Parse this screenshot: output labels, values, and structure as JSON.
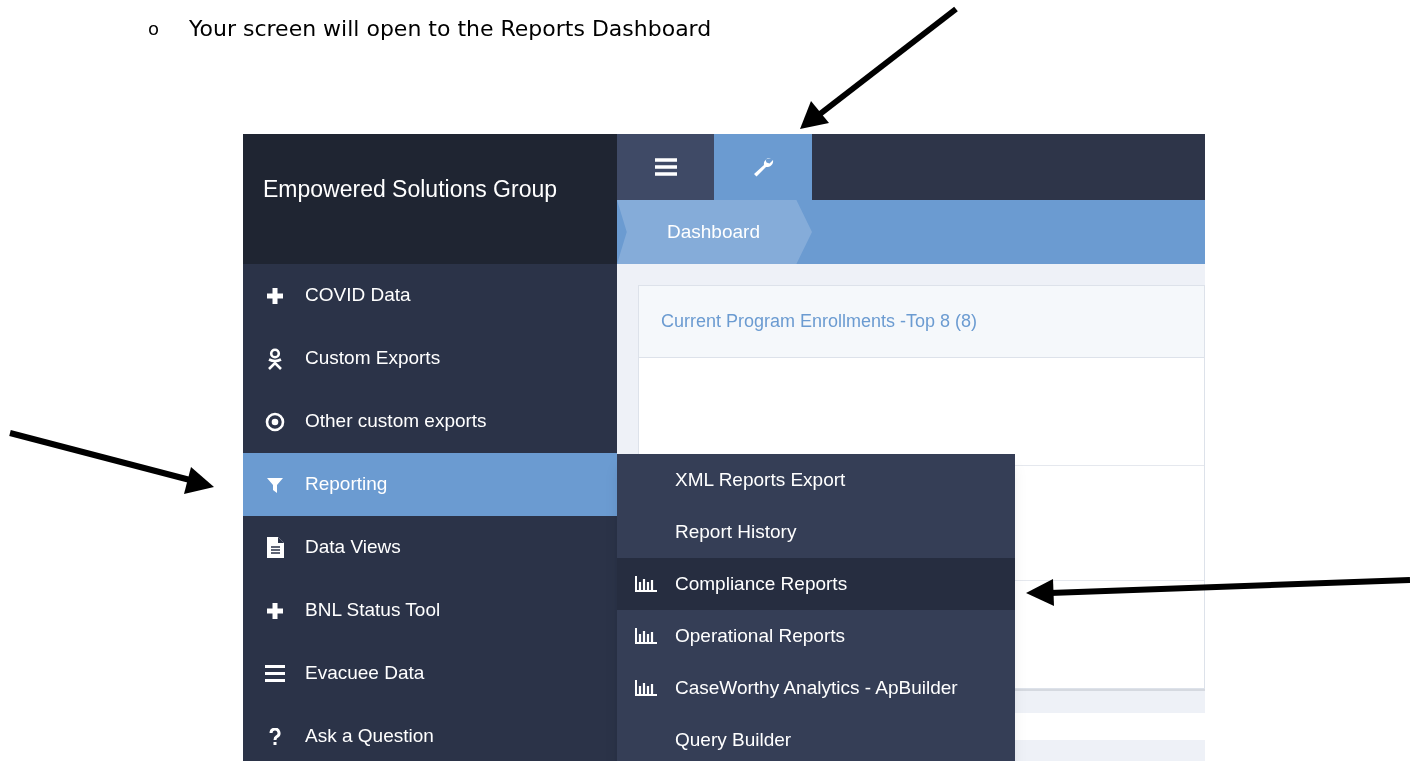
{
  "document": {
    "bullet": "o",
    "instruction": "Your screen will open to the Reports Dashboard"
  },
  "app": {
    "brand": "Empowered Solutions Group",
    "toolbar": [
      {
        "kind": "menu",
        "selected": false
      },
      {
        "kind": "tools",
        "selected": true
      }
    ],
    "breadcrumb": [
      "Dashboard"
    ],
    "sidebar": {
      "items": [
        {
          "label": "COVID Data",
          "selected": false
        },
        {
          "label": "Custom Exports",
          "selected": false
        },
        {
          "label": "Other custom exports",
          "selected": false
        },
        {
          "label": "Reporting",
          "selected": true
        },
        {
          "label": "Data Views",
          "selected": false
        },
        {
          "label": "BNL Status Tool",
          "selected": false
        },
        {
          "label": "Evacuee Data",
          "selected": false
        },
        {
          "label": "Ask a Question",
          "selected": false
        }
      ]
    },
    "submenu": [
      {
        "label": "XML Reports Export",
        "kind": "plain",
        "selected": false
      },
      {
        "label": "Report History",
        "kind": "plain",
        "selected": false
      },
      {
        "label": "Compliance Reports",
        "kind": "chart",
        "selected": true
      },
      {
        "label": "Operational Reports",
        "kind": "chart",
        "selected": false
      },
      {
        "label": "CaseWorthy Analytics - ApBuilder",
        "kind": "chart",
        "selected": false
      },
      {
        "label": "Query Builder",
        "kind": "plain",
        "selected": false
      }
    ],
    "panel": {
      "title": "Current Program Enrollments -Top 8 (8)"
    }
  }
}
